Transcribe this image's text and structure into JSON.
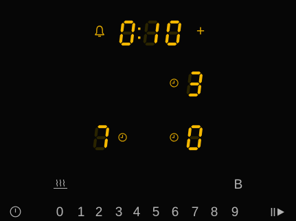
{
  "colors": {
    "segment_on": "#f5b800",
    "segment_dim": "#2a2400",
    "accent": "#e0a800",
    "control_text": "#b4b4b4"
  },
  "timer": {
    "icon": "bell-icon",
    "digits": [
      "0",
      "1",
      "0"
    ],
    "separator": ":",
    "plus_label": "+"
  },
  "zones": {
    "rear_right": {
      "level": "3",
      "timer_icon": "clock-icon"
    },
    "front_left": {
      "level": "7",
      "timer_icon": "clock-icon"
    },
    "front_right": {
      "level": "0",
      "timer_icon": "clock-icon"
    }
  },
  "controls": {
    "power_icon": "power-icon",
    "keep_warm_icon": "keep-warm-icon",
    "booster_label": "B",
    "power_levels": [
      "0",
      "1",
      "2",
      "3",
      "4",
      "5",
      "6",
      "7",
      "8",
      "9"
    ],
    "pause_icon": "pause-play-icon"
  }
}
